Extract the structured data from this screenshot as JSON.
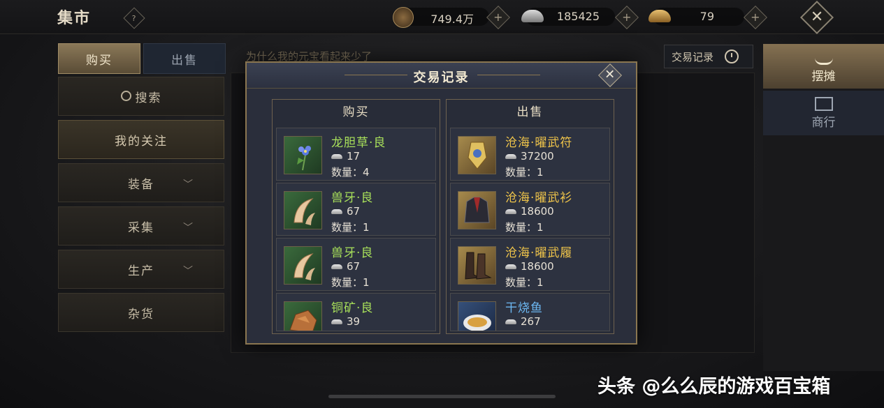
{
  "header": {
    "title": "集市",
    "help": "?",
    "currencies": [
      {
        "icon": "copper-coin-icon",
        "value": "749.4万"
      },
      {
        "icon": "silver-ingot-icon",
        "value": "185425"
      },
      {
        "icon": "gold-ingot-icon",
        "value": "79"
      }
    ],
    "plus": "+",
    "close": "✕"
  },
  "sidebar": {
    "tabs": {
      "buy": "购买",
      "sell": "出售"
    },
    "search": "搜索",
    "items": [
      {
        "label": "我的关注"
      },
      {
        "label": "装备"
      },
      {
        "label": "采集"
      },
      {
        "label": "生产"
      },
      {
        "label": "杂货"
      }
    ],
    "chevron": "﹀"
  },
  "main": {
    "question_link": "为什么我的元宝看起来少了",
    "record_button": "交易记录"
  },
  "right_tabs": [
    {
      "label": "摆摊",
      "icon": "stall-icon"
    },
    {
      "label": "商行",
      "icon": "shop-icon"
    }
  ],
  "modal": {
    "title": "交易记录",
    "close": "✕",
    "buy_header": "购买",
    "sell_header": "出售",
    "qty_label": "数量：",
    "buy_items": [
      {
        "name": "龙胆草·良",
        "price": "17",
        "qty": "4"
      },
      {
        "name": "兽牙·良",
        "price": "67",
        "qty": "1"
      },
      {
        "name": "兽牙·良",
        "price": "67",
        "qty": "1"
      },
      {
        "name": "铜矿·良",
        "price": "39",
        "qty": ""
      }
    ],
    "sell_items": [
      {
        "name": "沧海·曜武符",
        "price": "37200",
        "qty": "1"
      },
      {
        "name": "沧海·曜武衫",
        "price": "18600",
        "qty": "1"
      },
      {
        "name": "沧海·曜武履",
        "price": "18600",
        "qty": "1"
      },
      {
        "name": "干烧鱼",
        "price": "267",
        "qty": ""
      }
    ]
  },
  "watermark": "头条 @么么辰的游戏百宝箱",
  "colors": {
    "quality_good": "#a8e05a",
    "quality_gold": "#f0c54a",
    "quality_blue": "#6cb6f0",
    "frame_gold": "#8a7650"
  }
}
